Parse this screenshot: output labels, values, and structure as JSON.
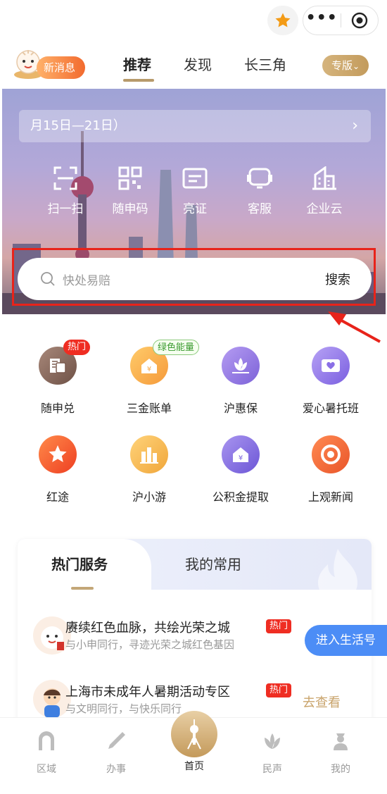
{
  "top": {
    "more_glyph": "•••"
  },
  "nav": {
    "news_label": "新消息",
    "tabs": [
      {
        "label": "推荐",
        "active": true
      },
      {
        "label": "发现",
        "active": false
      },
      {
        "label": "长三角",
        "active": false
      }
    ],
    "pro_label": "专版",
    "pro_chevron": "⌄"
  },
  "banner": {
    "date_text": "月15日—21日）",
    "date_chevron": "›",
    "quick_actions": [
      {
        "label": "扫一扫",
        "icon": "scan-icon"
      },
      {
        "label": "随申码",
        "icon": "qrcode-icon"
      },
      {
        "label": "亮证",
        "icon": "id-card-icon"
      },
      {
        "label": "客服",
        "icon": "headset-icon"
      },
      {
        "label": "企业云",
        "icon": "building-icon"
      }
    ]
  },
  "search": {
    "placeholder": "快处易赔",
    "button": "搜索"
  },
  "services": [
    {
      "label": "随申兑",
      "icon": "building-doc-icon",
      "color": "#8a6a5c",
      "badge": "热门",
      "badge_type": "hot"
    },
    {
      "label": "三金账单",
      "icon": "house-yen-icon",
      "color": "#f5a84a",
      "badge": "绿色能量",
      "badge_type": "green"
    },
    {
      "label": "沪惠保",
      "icon": "lotus-icon",
      "color": "#8a72e0",
      "badge": "",
      "badge_type": ""
    },
    {
      "label": "爱心暑托班",
      "icon": "heart-card-icon",
      "color": "#8a6fe6",
      "badge": "",
      "badge_type": ""
    },
    {
      "label": "红途",
      "icon": "star-icon",
      "color": "#f2542b",
      "badge": "",
      "badge_type": ""
    },
    {
      "label": "沪小游",
      "icon": "city-icon",
      "color": "#f4b64a",
      "badge": "",
      "badge_type": ""
    },
    {
      "label": "公积金提取",
      "icon": "house-yen-icon",
      "color": "#8068de",
      "badge": "",
      "badge_type": ""
    },
    {
      "label": "上观新闻",
      "icon": "shutter-icon",
      "color": "#f0652b",
      "badge": "",
      "badge_type": ""
    }
  ],
  "hot_card": {
    "tabs": [
      "热门服务",
      "我的常用"
    ],
    "rows": [
      {
        "title": "赓续红色血脉，共绘光荣之城",
        "tag": "热门",
        "subtitle": "与小申同行，寻迹光荣之城红色基因"
      },
      {
        "title": "上海市未成年人暑期活动专区",
        "tag": "热门",
        "subtitle": "与文明同行，与快乐同行"
      }
    ],
    "go_label": "去查看",
    "float_label": "进入生活号"
  },
  "tabbar": [
    {
      "label": "区域",
      "icon": "arch-icon",
      "active": false
    },
    {
      "label": "办事",
      "icon": "pen-icon",
      "active": false
    },
    {
      "label": "首页",
      "icon": "tower-icon",
      "active": true
    },
    {
      "label": "民声",
      "icon": "magnolia-icon",
      "active": false
    },
    {
      "label": "我的",
      "icon": "person-icon",
      "active": false
    }
  ]
}
